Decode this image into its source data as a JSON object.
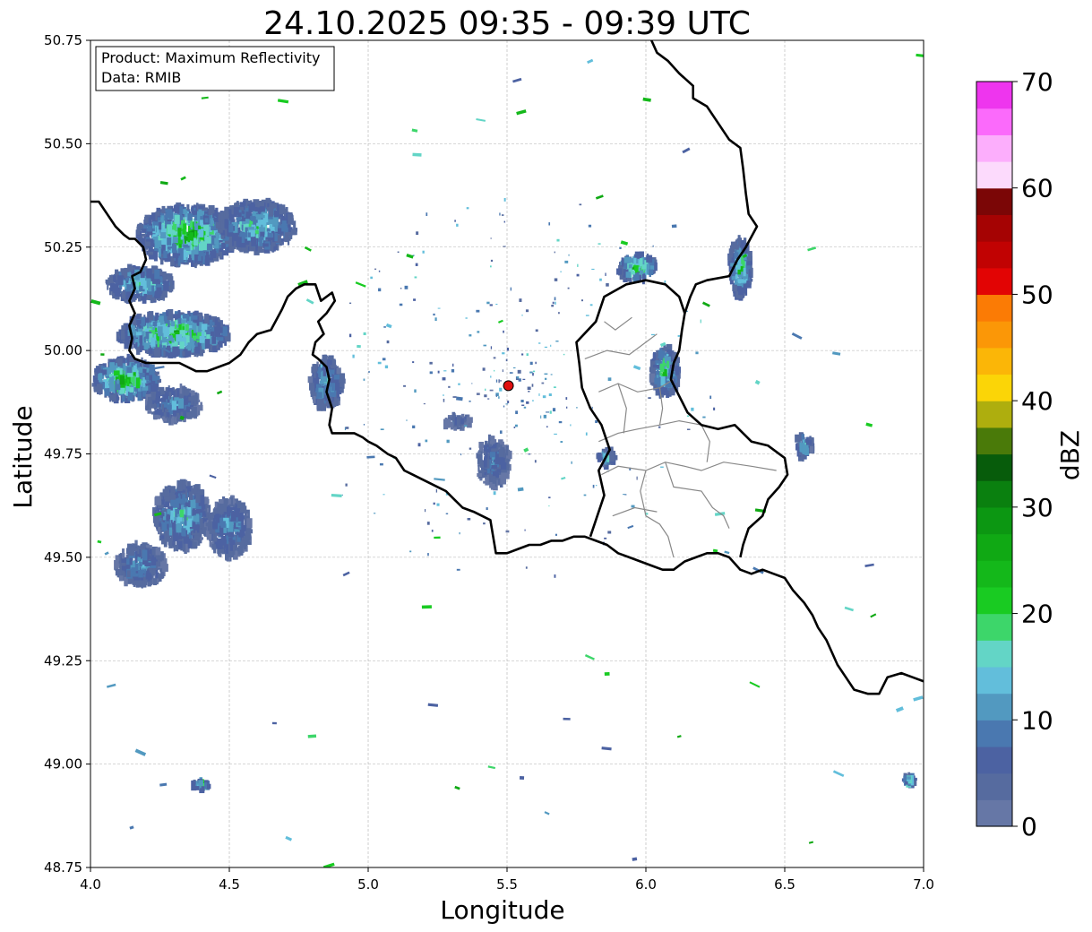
{
  "figure": {
    "title": "24.10.2025 09:35 - 09:39 UTC",
    "xlabel": "Longitude",
    "ylabel": "Latitude",
    "info_box": {
      "product_line": "Product: Maximum Reflectivity",
      "data_line": "Data: RMIB"
    },
    "colorbar": {
      "label": "dBZ",
      "range": [
        0,
        70
      ],
      "tick_labels": [
        "0",
        "10",
        "20",
        "30",
        "40",
        "50",
        "60",
        "70"
      ],
      "colors": [
        "#6677a6",
        "#566b9f",
        "#4c62a2",
        "#4a78b0",
        "#5299c0",
        "#62bedb",
        "#63d5c6",
        "#3dd66a",
        "#19cb22",
        "#14b81a",
        "#10a914",
        "#0c9712",
        "#0a800f",
        "#075c0b",
        "#4a7a09",
        "#aeae0e",
        "#fbd507",
        "#fbb607",
        "#fb9707",
        "#fb7b05",
        "#e20404",
        "#c10202",
        "#a50303",
        "#7b0606",
        "#fcdafc",
        "#fcaefc",
        "#fb6afb",
        "#ee35ee"
      ]
    }
  },
  "chart_data": {
    "type": "heatmap",
    "title": "24.10.2025 09:35 - 09:39 UTC",
    "xlabel": "Longitude",
    "ylabel": "Latitude",
    "xlim": [
      4.0,
      7.0
    ],
    "ylim": [
      48.75,
      50.75
    ],
    "xticks": [
      {
        "value": 4.0,
        "label": "4.0"
      },
      {
        "value": 4.5,
        "label": "4.5"
      },
      {
        "value": 5.0,
        "label": "5.0"
      },
      {
        "value": 5.5,
        "label": "5.5"
      },
      {
        "value": 6.0,
        "label": "6.0"
      },
      {
        "value": 6.5,
        "label": "6.5"
      },
      {
        "value": 7.0,
        "label": "7.0"
      }
    ],
    "yticks": [
      {
        "value": 48.75,
        "label": "48.75"
      },
      {
        "value": 49.0,
        "label": "49.00"
      },
      {
        "value": 49.25,
        "label": "49.25"
      },
      {
        "value": 49.5,
        "label": "49.50"
      },
      {
        "value": 49.75,
        "label": "49.75"
      },
      {
        "value": 50.0,
        "label": "50.00"
      },
      {
        "value": 50.25,
        "label": "50.25"
      },
      {
        "value": 50.5,
        "label": "50.50"
      },
      {
        "value": 50.75,
        "label": "50.75"
      }
    ],
    "grid": true,
    "radar_site": {
      "lon": 5.505,
      "lat": 49.915
    },
    "borders": [
      [
        [
          4.0,
          50.36
        ],
        [
          4.03,
          50.36
        ],
        [
          4.06,
          50.33
        ],
        [
          4.09,
          50.3
        ],
        [
          4.12,
          50.28
        ],
        [
          4.14,
          50.27
        ],
        [
          4.16,
          50.27
        ],
        [
          4.19,
          50.25
        ],
        [
          4.2,
          50.22
        ],
        [
          4.18,
          50.19
        ],
        [
          4.15,
          50.18
        ],
        [
          4.16,
          50.15
        ],
        [
          4.14,
          50.12
        ],
        [
          4.16,
          50.09
        ],
        [
          4.14,
          50.06
        ],
        [
          4.15,
          50.03
        ],
        [
          4.14,
          50.0
        ],
        [
          4.16,
          49.98
        ],
        [
          4.2,
          49.97
        ],
        [
          4.26,
          49.97
        ],
        [
          4.32,
          49.97
        ],
        [
          4.38,
          49.95
        ],
        [
          4.42,
          49.95
        ],
        [
          4.46,
          49.96
        ],
        [
          4.5,
          49.97
        ],
        [
          4.54,
          49.99
        ],
        [
          4.57,
          50.02
        ],
        [
          4.6,
          50.04
        ],
        [
          4.65,
          50.05
        ],
        [
          4.69,
          50.1
        ],
        [
          4.71,
          50.13
        ],
        [
          4.74,
          50.15
        ],
        [
          4.77,
          50.16
        ],
        [
          4.81,
          50.16
        ],
        [
          4.83,
          50.12
        ],
        [
          4.87,
          50.14
        ],
        [
          4.88,
          50.12
        ],
        [
          4.85,
          50.09
        ],
        [
          4.82,
          50.07
        ],
        [
          4.84,
          50.04
        ],
        [
          4.81,
          50.02
        ],
        [
          4.8,
          49.99
        ],
        [
          4.82,
          49.98
        ],
        [
          4.85,
          49.96
        ],
        [
          4.86,
          49.93
        ],
        [
          4.85,
          49.9
        ],
        [
          4.87,
          49.86
        ],
        [
          4.86,
          49.82
        ],
        [
          4.87,
          49.8
        ],
        [
          4.91,
          49.8
        ],
        [
          4.95,
          49.8
        ],
        [
          4.98,
          49.79
        ],
        [
          5.0,
          49.78
        ],
        [
          5.03,
          49.77
        ],
        [
          5.07,
          49.75
        ],
        [
          5.1,
          49.74
        ],
        [
          5.13,
          49.71
        ],
        [
          5.16,
          49.7
        ],
        [
          5.19,
          49.69
        ],
        [
          5.22,
          49.68
        ],
        [
          5.25,
          49.67
        ],
        [
          5.28,
          49.66
        ],
        [
          5.31,
          49.64
        ],
        [
          5.34,
          49.62
        ],
        [
          5.38,
          49.61
        ],
        [
          5.41,
          49.6
        ],
        [
          5.44,
          49.59
        ],
        [
          5.45,
          49.55
        ],
        [
          5.46,
          49.51
        ],
        [
          5.5,
          49.51
        ],
        [
          5.54,
          49.52
        ],
        [
          5.58,
          49.53
        ],
        [
          5.62,
          49.53
        ],
        [
          5.66,
          49.54
        ],
        [
          5.7,
          49.54
        ],
        [
          5.74,
          49.55
        ],
        [
          5.78,
          49.55
        ],
        [
          5.82,
          49.54
        ],
        [
          5.86,
          49.53
        ],
        [
          5.9,
          49.51
        ],
        [
          5.94,
          49.5
        ],
        [
          5.98,
          49.49
        ],
        [
          6.02,
          49.48
        ],
        [
          6.06,
          49.47
        ],
        [
          6.1,
          49.47
        ],
        [
          6.14,
          49.49
        ],
        [
          6.18,
          49.5
        ],
        [
          6.22,
          49.51
        ],
        [
          6.26,
          49.51
        ],
        [
          6.3,
          49.5
        ],
        [
          6.34,
          49.47
        ],
        [
          6.38,
          49.46
        ],
        [
          6.42,
          49.47
        ],
        [
          6.46,
          49.46
        ],
        [
          6.5,
          49.45
        ],
        [
          6.53,
          49.42
        ],
        [
          6.57,
          49.39
        ],
        [
          6.6,
          49.36
        ],
        [
          6.62,
          49.33
        ],
        [
          6.65,
          49.3
        ],
        [
          6.67,
          49.27
        ],
        [
          6.69,
          49.24
        ],
        [
          6.72,
          49.21
        ],
        [
          6.75,
          49.18
        ],
        [
          6.8,
          49.17
        ],
        [
          6.84,
          49.17
        ],
        [
          6.87,
          49.21
        ],
        [
          6.92,
          49.22
        ],
        [
          6.96,
          49.21
        ],
        [
          7.0,
          49.2
        ]
      ],
      [
        [
          6.02,
          50.75
        ],
        [
          6.04,
          50.72
        ],
        [
          6.08,
          50.7
        ],
        [
          6.12,
          50.67
        ],
        [
          6.17,
          50.64
        ],
        [
          6.17,
          50.61
        ],
        [
          6.22,
          50.59
        ],
        [
          6.25,
          50.56
        ],
        [
          6.3,
          50.51
        ],
        [
          6.34,
          50.49
        ],
        [
          6.35,
          50.44
        ],
        [
          6.36,
          50.38
        ],
        [
          6.37,
          50.33
        ],
        [
          6.4,
          50.3
        ],
        [
          6.36,
          50.25
        ],
        [
          6.33,
          50.22
        ],
        [
          6.3,
          50.18
        ],
        [
          6.22,
          50.17
        ],
        [
          6.18,
          50.16
        ],
        [
          6.16,
          50.13
        ],
        [
          6.14,
          50.09
        ],
        [
          6.13,
          50.05
        ],
        [
          6.12,
          50.0
        ],
        [
          6.1,
          49.97
        ],
        [
          6.09,
          49.93
        ],
        [
          6.12,
          49.89
        ],
        [
          6.15,
          49.85
        ],
        [
          6.2,
          49.82
        ],
        [
          6.26,
          49.81
        ],
        [
          6.32,
          49.82
        ],
        [
          6.38,
          49.78
        ],
        [
          6.44,
          49.77
        ],
        [
          6.5,
          49.74
        ],
        [
          6.51,
          49.7
        ],
        [
          6.48,
          49.67
        ],
        [
          6.44,
          49.64
        ],
        [
          6.42,
          49.6
        ],
        [
          6.37,
          49.57
        ],
        [
          6.35,
          49.53
        ],
        [
          6.34,
          49.5
        ]
      ],
      [
        [
          5.8,
          49.55
        ],
        [
          5.82,
          49.59
        ],
        [
          5.85,
          49.65
        ],
        [
          5.83,
          49.71
        ],
        [
          5.87,
          49.76
        ],
        [
          5.84,
          49.82
        ],
        [
          5.8,
          49.86
        ],
        [
          5.77,
          49.91
        ],
        [
          5.76,
          49.97
        ],
        [
          5.75,
          50.02
        ],
        [
          5.82,
          50.07
        ],
        [
          5.85,
          50.13
        ],
        [
          5.93,
          50.16
        ],
        [
          6.0,
          50.17
        ],
        [
          6.07,
          50.16
        ],
        [
          6.12,
          50.13
        ],
        [
          6.14,
          50.09
        ]
      ]
    ],
    "internal_boundaries": [
      [
        [
          5.83,
          49.9
        ],
        [
          5.9,
          49.92
        ],
        [
          5.97,
          49.9
        ],
        [
          6.05,
          49.91
        ],
        [
          6.1,
          49.93
        ]
      ],
      [
        [
          5.78,
          49.98
        ],
        [
          5.86,
          50.0
        ],
        [
          5.94,
          49.99
        ],
        [
          6.0,
          50.02
        ],
        [
          6.04,
          50.04
        ]
      ],
      [
        [
          5.85,
          50.07
        ],
        [
          5.89,
          50.05
        ],
        [
          5.95,
          50.08
        ]
      ],
      [
        [
          5.83,
          49.78
        ],
        [
          5.9,
          49.8
        ],
        [
          5.97,
          49.81
        ],
        [
          6.05,
          49.82
        ],
        [
          6.12,
          49.83
        ],
        [
          6.2,
          49.82
        ]
      ],
      [
        [
          5.84,
          49.7
        ],
        [
          5.9,
          49.72
        ],
        [
          6.0,
          49.71
        ],
        [
          6.07,
          49.73
        ],
        [
          6.14,
          49.72
        ],
        [
          6.2,
          49.71
        ],
        [
          6.28,
          49.73
        ],
        [
          6.38,
          49.72
        ],
        [
          6.47,
          49.71
        ]
      ],
      [
        [
          6.0,
          49.71
        ],
        [
          5.98,
          49.66
        ],
        [
          6.0,
          49.6
        ],
        [
          6.05,
          49.58
        ],
        [
          6.08,
          49.55
        ],
        [
          6.1,
          49.5
        ]
      ],
      [
        [
          6.07,
          49.73
        ],
        [
          6.1,
          49.67
        ],
        [
          6.2,
          49.66
        ],
        [
          6.24,
          49.62
        ],
        [
          6.28,
          49.6
        ],
        [
          6.3,
          49.57
        ]
      ],
      [
        [
          6.2,
          49.82
        ],
        [
          6.23,
          49.78
        ],
        [
          6.22,
          49.73
        ]
      ],
      [
        [
          5.9,
          49.92
        ],
        [
          5.93,
          49.86
        ],
        [
          5.92,
          49.8
        ]
      ],
      [
        [
          6.05,
          49.91
        ],
        [
          6.06,
          49.86
        ],
        [
          6.05,
          49.82
        ]
      ],
      [
        [
          5.88,
          49.6
        ],
        [
          5.96,
          49.62
        ],
        [
          6.04,
          49.61
        ]
      ]
    ],
    "echoes": [
      {
        "lon": 4.35,
        "lat": 50.28,
        "r_lon": 0.18,
        "r_lat": 0.07,
        "peak_dbz": 30
      },
      {
        "lon": 4.6,
        "lat": 50.3,
        "r_lon": 0.14,
        "r_lat": 0.06,
        "peak_dbz": 22
      },
      {
        "lon": 4.18,
        "lat": 50.16,
        "r_lon": 0.12,
        "r_lat": 0.04,
        "peak_dbz": 22
      },
      {
        "lon": 4.3,
        "lat": 50.04,
        "r_lon": 0.2,
        "r_lat": 0.05,
        "peak_dbz": 30
      },
      {
        "lon": 4.13,
        "lat": 49.93,
        "r_lon": 0.12,
        "r_lat": 0.05,
        "peak_dbz": 30
      },
      {
        "lon": 4.3,
        "lat": 49.87,
        "r_lon": 0.1,
        "r_lat": 0.04,
        "peak_dbz": 15
      },
      {
        "lon": 4.85,
        "lat": 49.92,
        "r_lon": 0.06,
        "r_lat": 0.06,
        "peak_dbz": 18
      },
      {
        "lon": 4.33,
        "lat": 49.6,
        "r_lon": 0.1,
        "r_lat": 0.08,
        "peak_dbz": 20
      },
      {
        "lon": 4.18,
        "lat": 49.48,
        "r_lon": 0.09,
        "r_lat": 0.05,
        "peak_dbz": 15
      },
      {
        "lon": 4.5,
        "lat": 49.57,
        "r_lon": 0.08,
        "r_lat": 0.07,
        "peak_dbz": 15
      },
      {
        "lon": 5.45,
        "lat": 49.73,
        "r_lon": 0.06,
        "r_lat": 0.06,
        "peak_dbz": 12
      },
      {
        "lon": 5.32,
        "lat": 49.83,
        "r_lon": 0.05,
        "r_lat": 0.015,
        "peak_dbz": 10
      },
      {
        "lon": 5.97,
        "lat": 50.2,
        "r_lon": 0.07,
        "r_lat": 0.03,
        "peak_dbz": 30
      },
      {
        "lon": 6.34,
        "lat": 50.2,
        "r_lon": 0.04,
        "r_lat": 0.07,
        "peak_dbz": 25
      },
      {
        "lon": 6.07,
        "lat": 49.95,
        "r_lon": 0.05,
        "r_lat": 0.06,
        "peak_dbz": 25
      },
      {
        "lon": 5.86,
        "lat": 49.74,
        "r_lon": 0.03,
        "r_lat": 0.02,
        "peak_dbz": 20
      },
      {
        "lon": 6.57,
        "lat": 49.77,
        "r_lon": 0.03,
        "r_lat": 0.03,
        "peak_dbz": 20
      },
      {
        "lon": 4.4,
        "lat": 48.95,
        "r_lon": 0.03,
        "r_lat": 0.01,
        "peak_dbz": 30
      },
      {
        "lon": 6.95,
        "lat": 48.96,
        "r_lon": 0.02,
        "r_lat": 0.01,
        "peak_dbz": 25
      }
    ]
  }
}
